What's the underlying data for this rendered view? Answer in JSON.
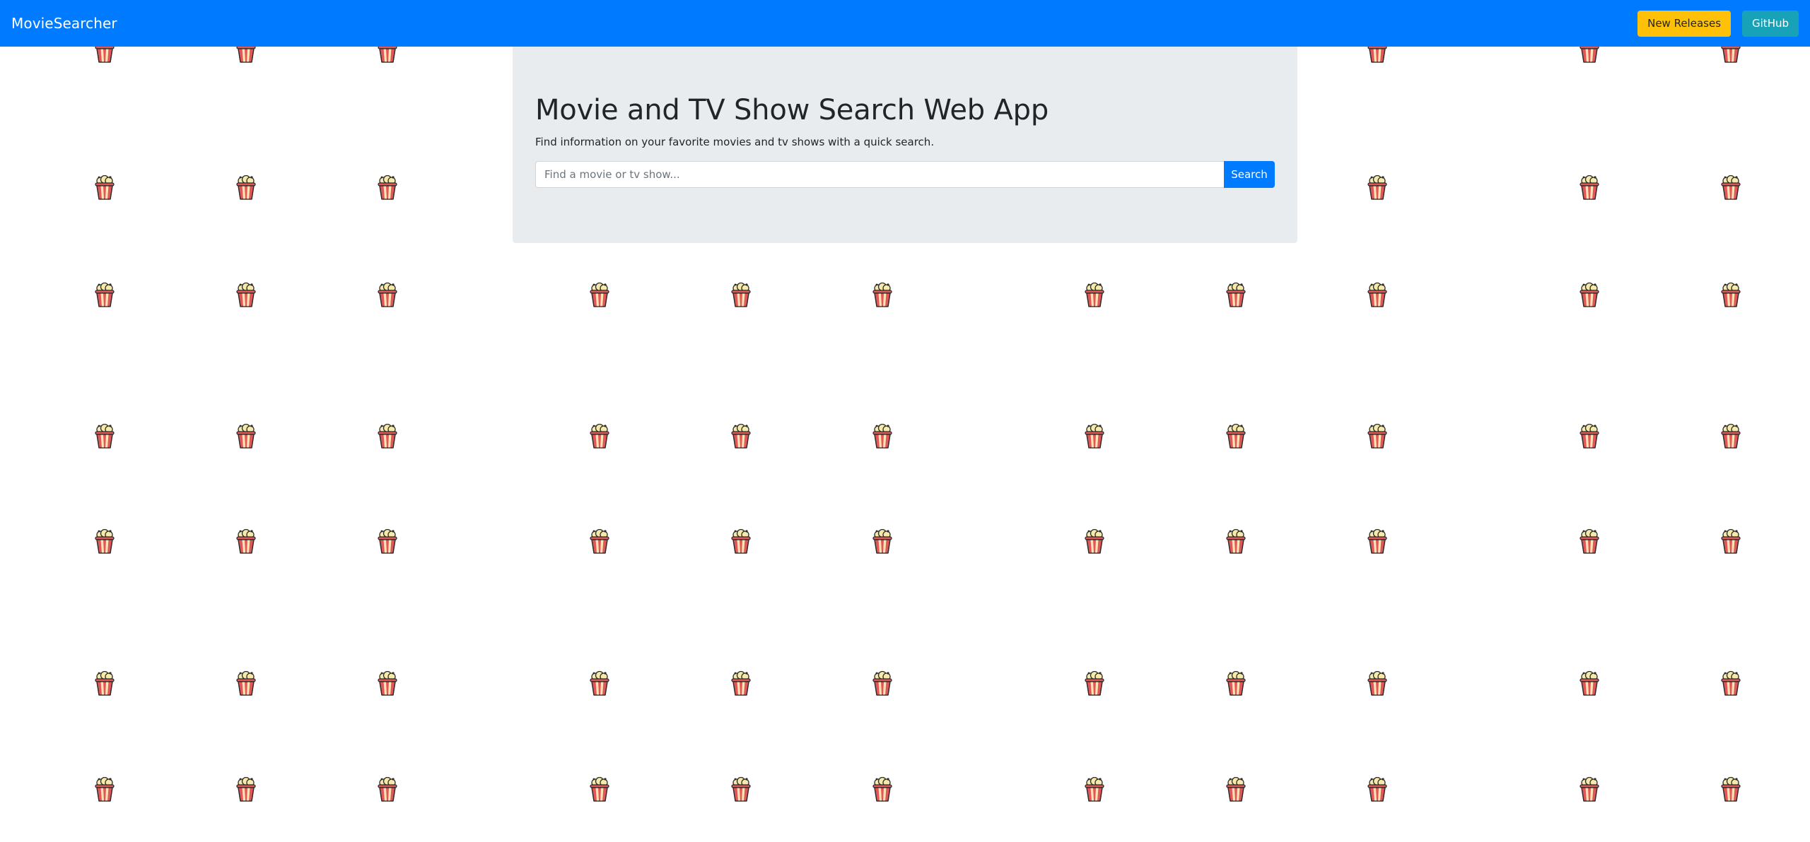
{
  "navbar": {
    "brand": "MovieSearcher",
    "new_releases_label": "New Releases",
    "github_label": "GitHub",
    "background_color": "#007bff"
  },
  "hero": {
    "title": "Movie and TV Show Search Web App",
    "subtitle": "Find information on your favorite movies and tv shows with a quick search.",
    "search_placeholder": "Find a movie or tv show...",
    "search_value": "",
    "search_button_label": "Search"
  },
  "background": {
    "icon": "popcorn-icon",
    "colors": {
      "bucket_red": "#e05757",
      "bucket_stripe": "#ffe3b5",
      "kernels": "#f7e9a8",
      "outline": "#2b2b2b"
    }
  }
}
